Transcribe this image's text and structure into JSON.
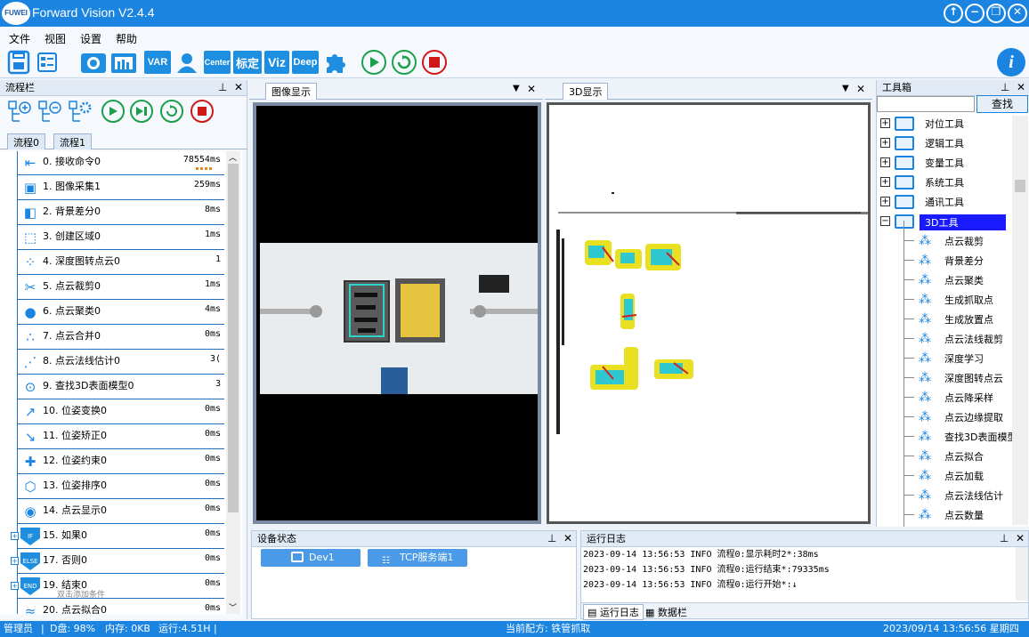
{
  "app": {
    "logo": "FUWEI",
    "title": "Forward Vision V2.4.4",
    "win_controls": [
      "↑",
      "−",
      "❐",
      "✕"
    ]
  },
  "menu": [
    "文件",
    "视图",
    "设置",
    "帮助"
  ],
  "toolbar": {
    "var": "VAR",
    "center": "Center",
    "calib": "标定",
    "viz": "Viz",
    "deep": "Deep",
    "info": "i"
  },
  "flow_panel": {
    "title": "流程栏",
    "tabs": [
      "流程0",
      "流程1"
    ],
    "items": [
      {
        "name": "0. 接收命令0",
        "time": "78554ms",
        "icon": "receive-command-icon"
      },
      {
        "name": "1. 图像采集1",
        "time": "259ms",
        "icon": "image-capture-icon"
      },
      {
        "name": "2. 背景差分0",
        "time": "8ms",
        "icon": "background-diff-icon"
      },
      {
        "name": "3. 创建区域0",
        "time": "1ms",
        "icon": "create-region-icon"
      },
      {
        "name": "4. 深度图转点云0",
        "time": "1",
        "icon": "depth-to-cloud-icon"
      },
      {
        "name": "5. 点云裁剪0",
        "time": "1ms",
        "icon": "cloud-crop-icon"
      },
      {
        "name": "6. 点云聚类0",
        "time": "4ms",
        "icon": "cloud-cluster-icon"
      },
      {
        "name": "7. 点云合并0",
        "time": "0ms",
        "icon": "cloud-merge-icon"
      },
      {
        "name": "8. 点云法线估计0",
        "time": "3(",
        "icon": "normal-estimate-icon"
      },
      {
        "name": "9. 查找3D表面模型0",
        "time": "3",
        "icon": "find-3d-model-icon"
      },
      {
        "name": "10. 位姿变换0",
        "time": "0ms",
        "icon": "pose-transform-icon"
      },
      {
        "name": "11. 位姿矫正0",
        "time": "0ms",
        "icon": "pose-correct-icon"
      },
      {
        "name": "12. 位姿约束0",
        "time": "0ms",
        "icon": "pose-constraint-icon"
      },
      {
        "name": "13. 位姿排序0",
        "time": "0ms",
        "icon": "pose-sort-icon"
      },
      {
        "name": "14. 点云显示0",
        "time": "0ms",
        "icon": "cloud-display-icon"
      },
      {
        "name": "15. 如果0",
        "time": "0ms",
        "icon": "if-icon"
      },
      {
        "name": "17. 否则0",
        "time": "0ms",
        "icon": "else-icon"
      },
      {
        "name": "19. 结束0",
        "time": "0ms",
        "icon": "end-icon"
      },
      {
        "name": "20. 点云拟合0",
        "time": "0ms",
        "icon": "cloud-fit-icon"
      }
    ],
    "hint": "双击添加条件",
    "icon_labels": {
      "if": "IF",
      "else": "ELSE",
      "end": "END"
    }
  },
  "image_panel": {
    "tab": "图像显示"
  },
  "view3d_panel": {
    "tab": "3D显示"
  },
  "toolbox": {
    "title": "工具箱",
    "search_button": "查找",
    "groups": [
      "对位工具",
      "逻辑工具",
      "变量工具",
      "系统工具",
      "通讯工具",
      "3D工具"
    ],
    "tools": [
      "点云裁剪",
      "背景差分",
      "点云聚类",
      "生成抓取点",
      "生成放置点",
      "点云法线裁剪",
      "深度学习",
      "深度图转点云",
      "点云降采样",
      "点云边缘提取",
      "查找3D表面模型",
      "点云拟合",
      "点云加载",
      "点云法线估计",
      "点云数量"
    ]
  },
  "device_panel": {
    "title": "设备状态",
    "devices": [
      "Dev1",
      "TCP服务端1"
    ]
  },
  "log_panel": {
    "title": "运行日志",
    "lines": [
      "2023-09-14 13:56:53 INFO  流程0:显示耗时2*:38ms",
      "2023-09-14 13:56:53 INFO  流程0:运行结束*:79335ms",
      "2023-09-14 13:56:53 INFO  流程0:运行开始*:↓"
    ],
    "tabs": [
      "运行日志",
      "数据栏"
    ]
  },
  "status": {
    "user": "管理员",
    "disk": "D盘: 98%",
    "memory": "内存: 0KB",
    "runtime": "运行:4.51H",
    "recipe": "当前配方: 铁管抓取",
    "datetime": "2023/09/14 13:56:56 星期四"
  },
  "colors": {
    "accent": "#1a84e0",
    "flow_border": "#1f6fc0",
    "selected": "#1a1aff"
  }
}
